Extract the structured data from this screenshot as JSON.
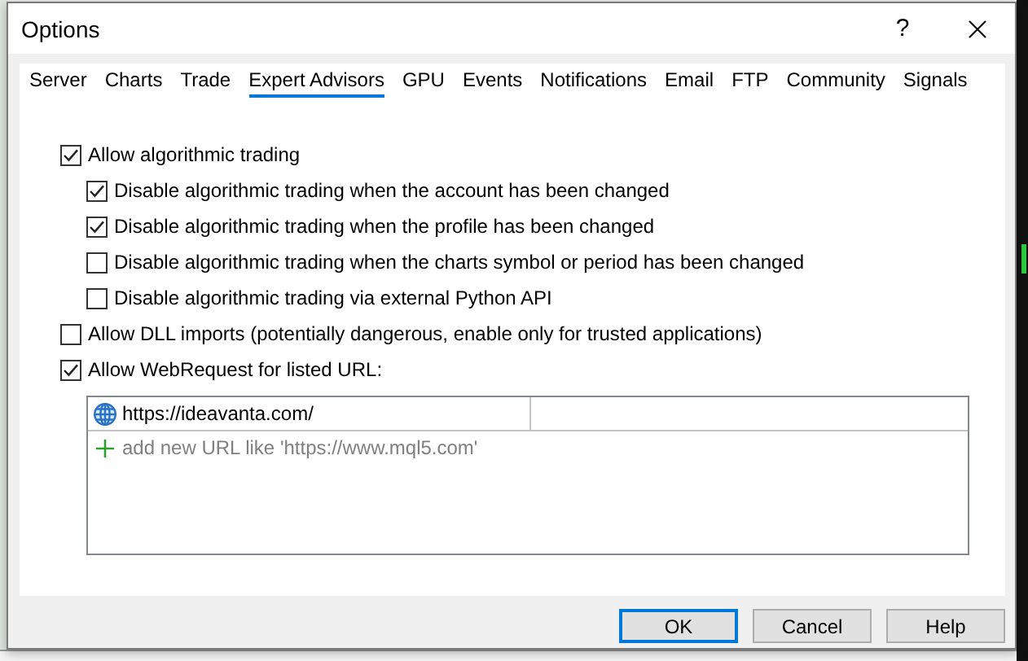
{
  "window": {
    "title": "Options",
    "help": "?"
  },
  "tabs": [
    {
      "label": "Server",
      "selected": false
    },
    {
      "label": "Charts",
      "selected": false
    },
    {
      "label": "Trade",
      "selected": false
    },
    {
      "label": "Expert Advisors",
      "selected": true
    },
    {
      "label": "GPU",
      "selected": false
    },
    {
      "label": "Events",
      "selected": false
    },
    {
      "label": "Notifications",
      "selected": false
    },
    {
      "label": "Email",
      "selected": false
    },
    {
      "label": "FTP",
      "selected": false
    },
    {
      "label": "Community",
      "selected": false
    },
    {
      "label": "Signals",
      "selected": false
    }
  ],
  "options": [
    {
      "label": "Allow algorithmic trading",
      "checked": true,
      "children": [
        {
          "label": "Disable algorithmic trading when the account has been changed",
          "checked": true
        },
        {
          "label": "Disable algorithmic trading when the profile has been changed",
          "checked": true
        },
        {
          "label": "Disable algorithmic trading when the charts symbol or period has been changed",
          "checked": false
        },
        {
          "label": "Disable algorithmic trading via external Python API",
          "checked": false
        }
      ]
    },
    {
      "label": "Allow DLL imports (potentially dangerous, enable only for trusted applications)",
      "checked": false
    },
    {
      "label": "Allow WebRequest for listed URL:",
      "checked": true
    }
  ],
  "url_list": {
    "rows": [
      {
        "url": "https://ideavanta.com/"
      }
    ],
    "add_hint": "add new URL like 'https://www.mql5.com'"
  },
  "buttons": [
    {
      "label": "OK",
      "default": true
    },
    {
      "label": "Cancel",
      "default": false
    },
    {
      "label": "Help",
      "default": false
    }
  ]
}
